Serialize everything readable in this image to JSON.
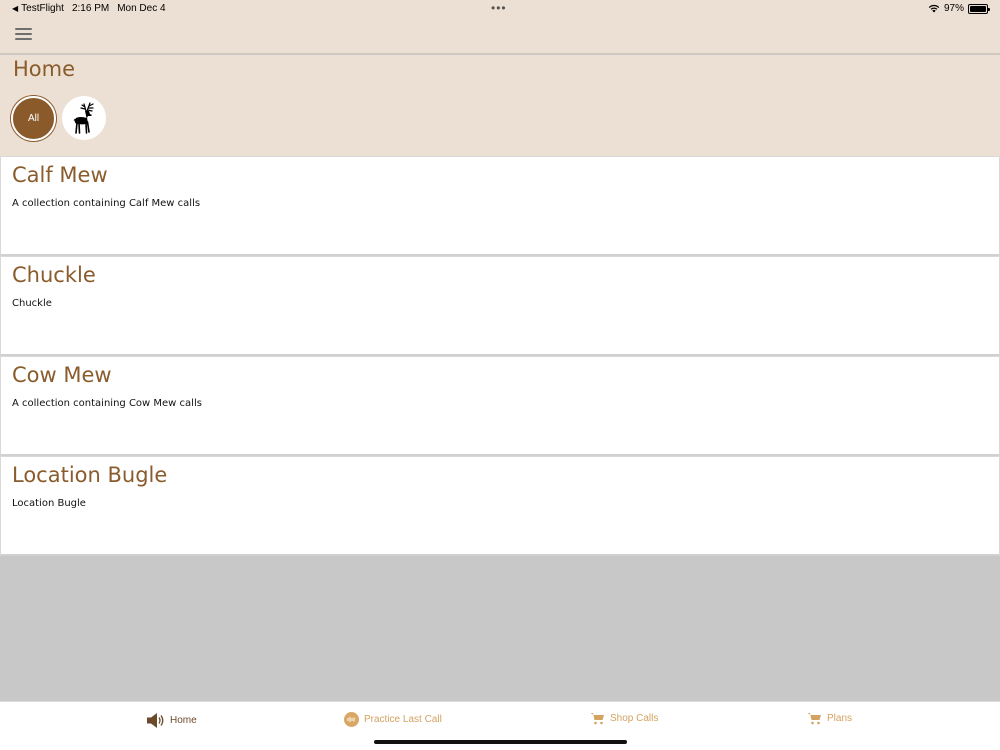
{
  "status_bar": {
    "back_app": "TestFlight",
    "time": "2:16 PM",
    "date": "Mon Dec 4",
    "dots": "•••",
    "battery_percent": "97%",
    "battery_level": 0.97
  },
  "header": {
    "title": "Home",
    "filters": [
      {
        "label": "All",
        "selected": true
      },
      {
        "icon": "elk-icon",
        "selected": false
      }
    ]
  },
  "collections": [
    {
      "title": "Calf Mew",
      "description": "A collection containing Calf Mew calls"
    },
    {
      "title": "Chuckle",
      "description": "Chuckle"
    },
    {
      "title": "Cow Mew",
      "description": "A collection containing Cow Mew calls"
    },
    {
      "title": "Location Bugle",
      "description": "Location Bugle"
    }
  ],
  "tab_bar": {
    "tabs": [
      {
        "label": "Home",
        "icon": "speaker-icon",
        "active": true
      },
      {
        "label": "Practice Last Call",
        "icon": "practice-icon",
        "active": false
      },
      {
        "label": "Shop Calls",
        "icon": "cart-icon",
        "active": false
      },
      {
        "label": "Plans",
        "icon": "cart-icon",
        "active": false
      }
    ]
  },
  "colors": {
    "header_bg": "#ece0d4",
    "accent_brown": "#8b5a2b",
    "tab_inactive": "#d4a261",
    "empty_bg": "#c8c8c8"
  }
}
